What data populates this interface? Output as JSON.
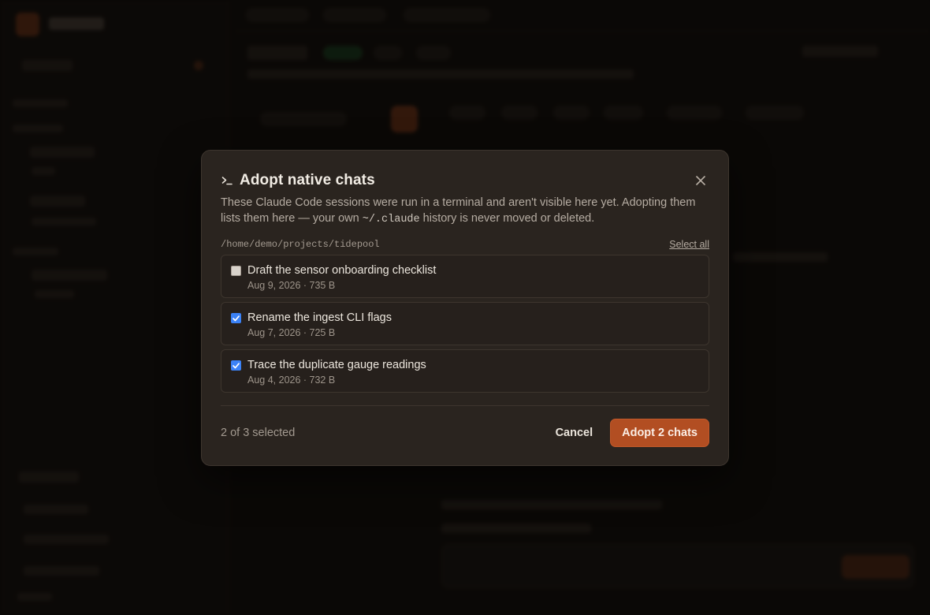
{
  "dialog": {
    "title": "Adopt native chats",
    "description_part1": "These Claude Code sessions were run in a terminal and aren't visible here yet. Adopting them lists them here — your own ",
    "description_code": "~/.claude",
    "description_part2": " history is never moved or deleted.",
    "path": "/home/demo/projects/tidepool",
    "select_all_label": "Select all",
    "icons": {
      "title": "terminal-icon",
      "close": "close-icon",
      "check": "check-icon"
    },
    "chats": [
      {
        "title": "Draft the sensor onboarding checklist",
        "meta": "Aug 9, 2026 · 735 B",
        "checked": false
      },
      {
        "title": "Rename the ingest CLI flags",
        "meta": "Aug 7, 2026 · 725 B",
        "checked": true
      },
      {
        "title": "Trace the duplicate gauge readings",
        "meta": "Aug 4, 2026 · 732 B",
        "checked": true
      }
    ],
    "selected_count": "2 of 3 selected",
    "cancel_label": "Cancel",
    "adopt_label": "Adopt 2 chats"
  },
  "colors": {
    "accent": "#b24e22",
    "checkbox": "#3b82f6",
    "modal_bg": "#2a241f"
  }
}
